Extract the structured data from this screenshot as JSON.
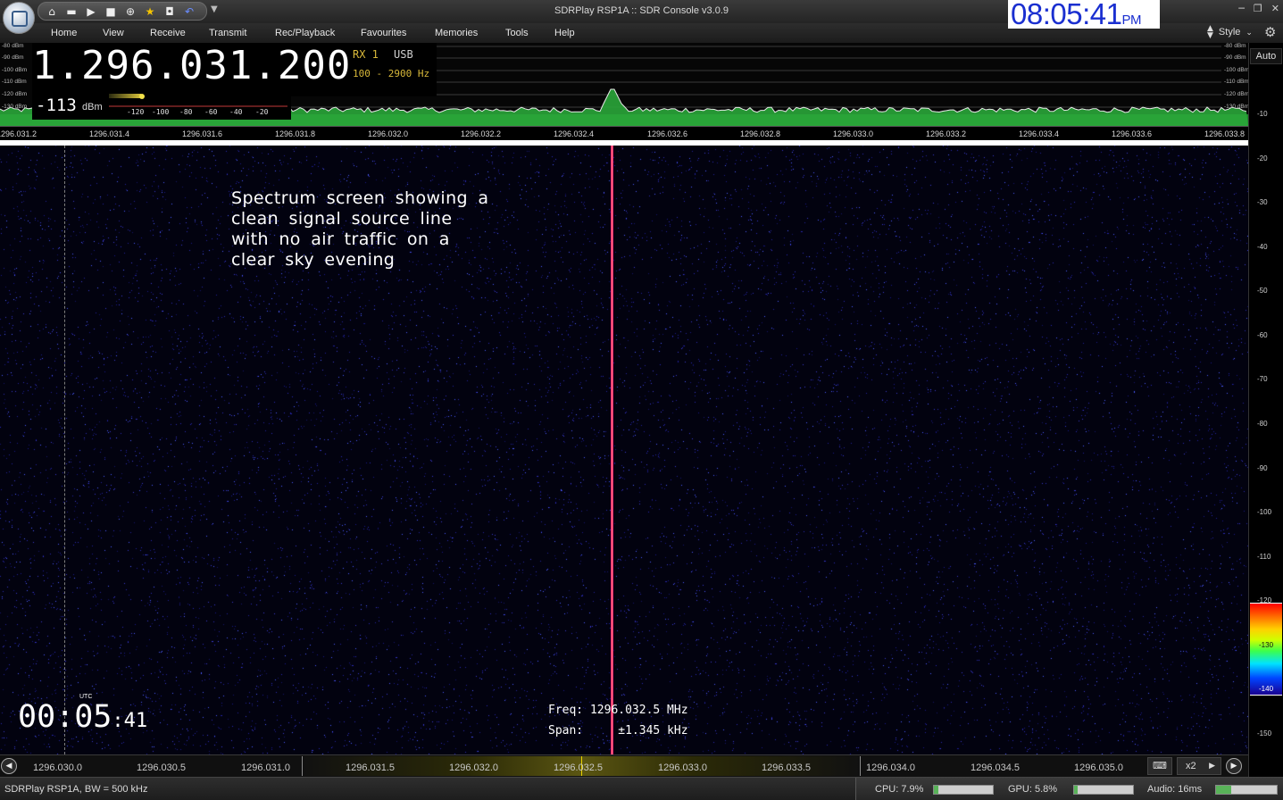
{
  "window": {
    "title": "SDRPlay RSP1A :: SDR Console v3.0.9",
    "clock_time": "08:05:41",
    "clock_ampm": "PM"
  },
  "menu": {
    "items": [
      "Home",
      "View",
      "Receive",
      "Transmit",
      "Rec/Playback",
      "Favourites",
      "Memories",
      "Tools",
      "Help"
    ],
    "style_label": "Style"
  },
  "receiver": {
    "frequency": "1.296.031.200",
    "rx": "RX 1",
    "mode": "USB",
    "bandwidth": "100 - 2900 Hz",
    "signal_value": "-113",
    "signal_unit": "dBm",
    "smeter_scale": [
      "-120",
      "-100",
      "-80",
      "-60",
      "-40",
      "-20"
    ]
  },
  "spectrum": {
    "dbm_left": [
      "-80 dBm",
      "-90 dBm",
      "-100 dBm",
      "-110 dBm",
      "-120 dBm",
      "-130 dBm"
    ],
    "dbm_right": [
      "-80 dBm",
      "-90 dBm",
      "-100 dBm",
      "-110 dBm",
      "-120 dBm",
      "-130 dBm"
    ],
    "scale_labels": [
      "1296.031.2",
      "1296.031.4",
      "1296.031.6",
      "1296.031.8",
      "1296.032.0",
      "1296.032.2",
      "1296.032.4",
      "1296.032.6",
      "1296.032.8",
      "1296.033.0",
      "1296.033.2",
      "1296.033.4",
      "1296.033.6",
      "1296.033.8"
    ]
  },
  "waterfall": {
    "note": "Spectrum screen showing a clean signal source line with no air traffic on a clear sky evening",
    "utc_label": "UTC",
    "utc_hm": "00:05",
    "utc_sec": ":41",
    "cursor_freq_label": "Freq:",
    "cursor_freq_value": "1296.032.5 MHz",
    "cursor_span_label": "Span:",
    "cursor_span_value": "±1.345 kHz"
  },
  "db_scale": {
    "auto_label": "Auto",
    "labels": [
      "-10",
      "-20",
      "-30",
      "-40",
      "-50",
      "-60",
      "-70",
      "-80",
      "-90",
      "-100",
      "-110",
      "-120",
      "-150"
    ],
    "colorbar_labels": [
      "-130",
      "-140"
    ]
  },
  "bottom": {
    "labels": [
      "1296.030.0",
      "1296.030.5",
      "1296.031.0",
      "1296.031.5",
      "1296.032.0",
      "1296.032.5",
      "1296.033.0",
      "1296.033.5",
      "1296.034.0",
      "1296.034.5",
      "1296.035.0"
    ],
    "zoom": "x2"
  },
  "status": {
    "left": "SDRPlay RSP1A, BW = 500 kHz",
    "cpu": "CPU: 7.9%",
    "cpu_level": 0.079,
    "gpu": "GPU: 5.8%",
    "gpu_level": 0.058,
    "audio": "Audio: 16ms",
    "audio_level": 0.25
  },
  "colors": {
    "signal": "#f0177a",
    "spectrum_fill": "#1e8a2a",
    "clock_text": "#1a2fd0"
  }
}
